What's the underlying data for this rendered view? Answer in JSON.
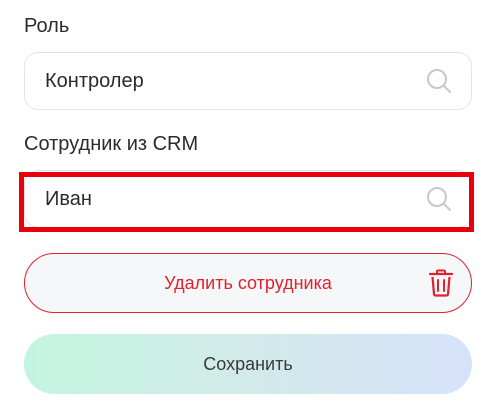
{
  "role": {
    "label": "Роль",
    "value": "Контролер",
    "icon": "search-icon"
  },
  "employee": {
    "label": "Сотрудник из CRM",
    "value": "Иван",
    "icon": "search-icon"
  },
  "actions": {
    "delete_label": "Удалить сотрудника",
    "delete_icon": "trash-icon",
    "save_label": "Сохранить"
  },
  "colors": {
    "danger": "#e0222c",
    "highlight": "#e8000b",
    "field_border": "#e3e3e8",
    "save_gradient_start": "#c4f5e0",
    "save_gradient_end": "#d6e2fb"
  }
}
